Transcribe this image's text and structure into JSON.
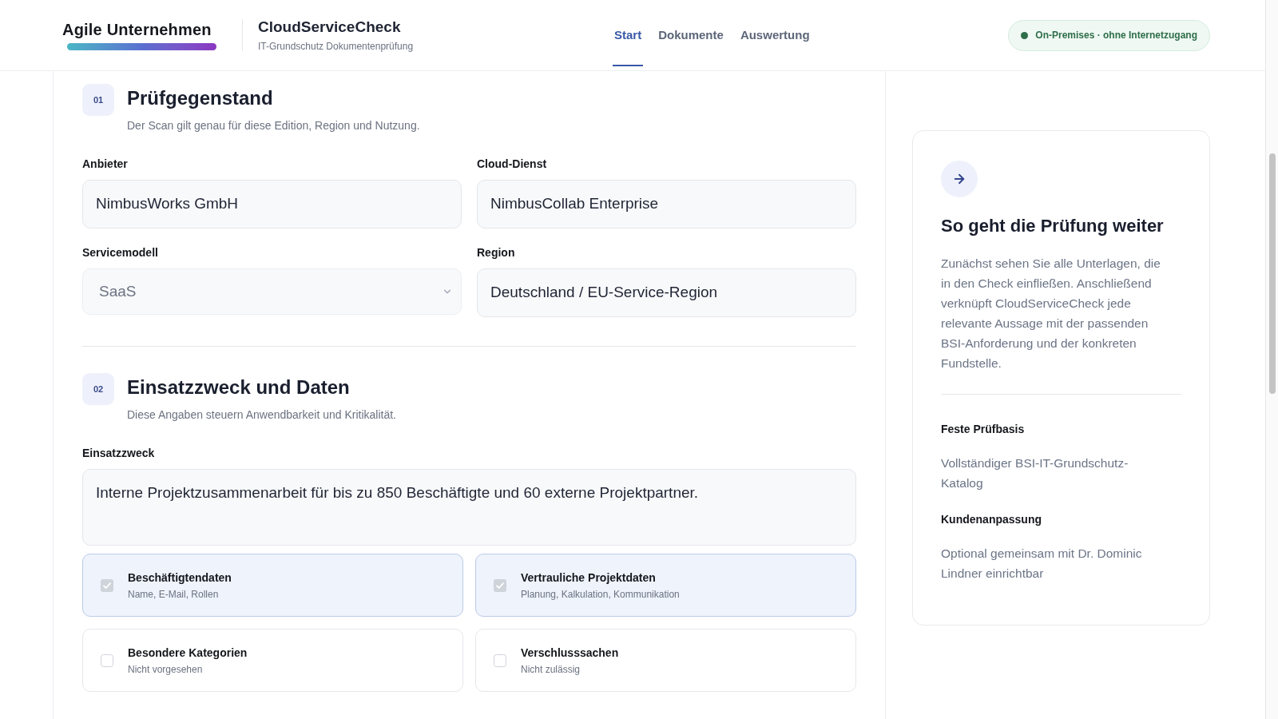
{
  "header": {
    "brand": {
      "name": "Agile Unternehmen"
    },
    "app": {
      "title": "CloudServiceCheck",
      "subtitle": "IT-Grundschutz Dokumentenprüfung"
    },
    "nav": [
      {
        "label": "Start",
        "selected": true
      },
      {
        "label": "Dokumente",
        "selected": false
      },
      {
        "label": "Auswertung",
        "selected": false
      }
    ],
    "status_badge": {
      "label": "On-Premises · ohne Internetzugang"
    }
  },
  "sections": [
    {
      "number": "01",
      "title": "Prüfgegenstand",
      "subtitle": "Der Scan gilt genau für diese Edition, Region und Nutzung.",
      "fields": [
        {
          "label": "Anbieter",
          "kind": "input",
          "value": "NimbusWorks GmbH"
        },
        {
          "label": "Cloud-Dienst",
          "kind": "input",
          "value": "NimbusCollab Enterprise"
        },
        {
          "label": "Servicemodell",
          "kind": "select",
          "value": "SaaS"
        },
        {
          "label": "Region",
          "kind": "input",
          "value": "Deutschland / EU-Service-Region"
        }
      ]
    },
    {
      "number": "02",
      "title": "Einsatzzweck und Daten",
      "subtitle": "Diese Angaben steuern Anwendbarkeit und Kritikalität.",
      "fields": [
        {
          "label": "Einsatzzweck",
          "kind": "textarea",
          "value": "Interne Projektzusammenarbeit für bis zu 850 Beschäftigte und 60 externe Projektpartner."
        }
      ],
      "options": [
        {
          "title": "Beschäftigtendaten",
          "description": "Name, E-Mail, Rollen",
          "checked": true
        },
        {
          "title": "Vertrauliche Projektdaten",
          "description": "Planung, Kalkulation, Kommunikation",
          "checked": true
        },
        {
          "title": "Besondere Kategorien",
          "description": "Nicht vorgesehen",
          "checked": false
        },
        {
          "title": "Verschlusssachen",
          "description": "Nicht zulässig",
          "checked": false
        }
      ]
    }
  ],
  "side_panel": {
    "title": "So geht die Prüfung weiter",
    "text": "Zunächst sehen Sie alle Unterlagen, die in den Check einfließen. Anschließend verknüpft CloudServiceCheck jede relevante Aussage mit der passenden BSI-Anforderung und der konkreten Fundstelle.",
    "details": [
      {
        "label": "Feste Prüfbasis",
        "value": "Vollständiger BSI-IT-Grundschutz-Katalog"
      },
      {
        "label": "Kundenanpassung",
        "value": "Optional gemeinsam mit Dr. Dominic Lindner einrichtbar"
      }
    ]
  }
}
